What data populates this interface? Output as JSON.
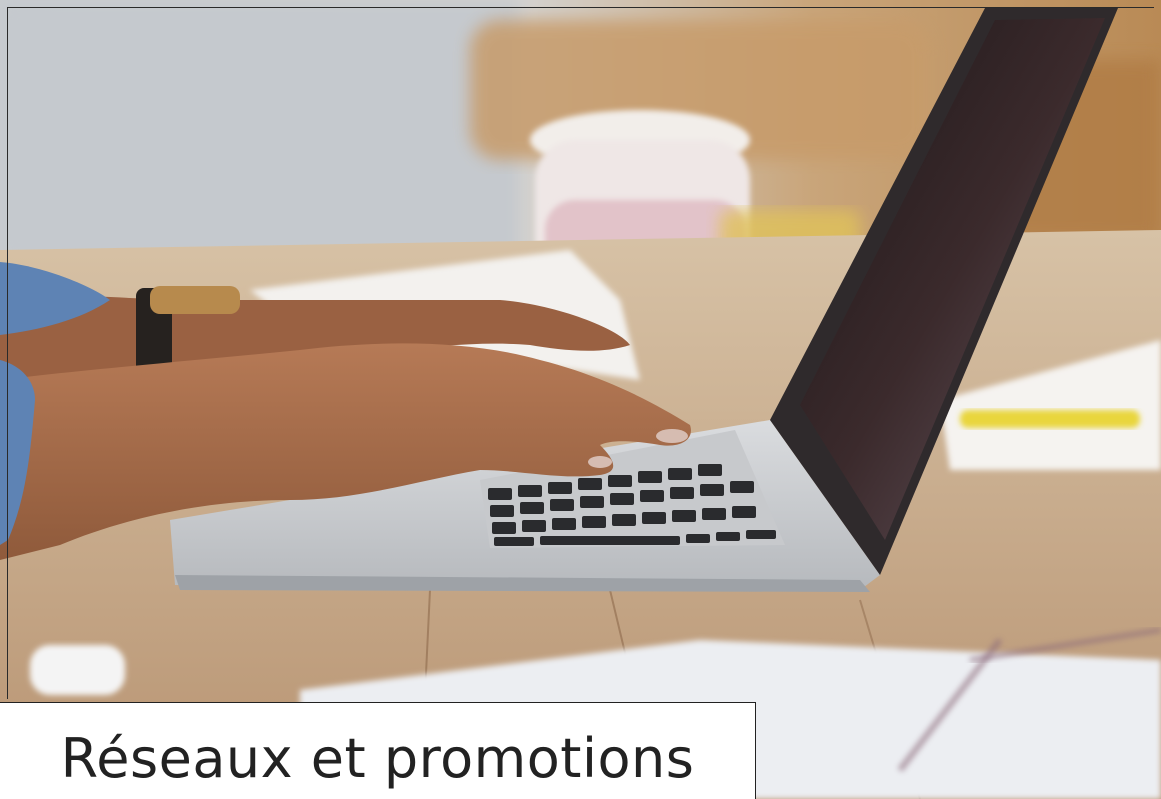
{
  "caption": {
    "text": "Réseaux et promotions"
  },
  "photo": {
    "subject": "hands-typing-on-laptop-icon"
  }
}
